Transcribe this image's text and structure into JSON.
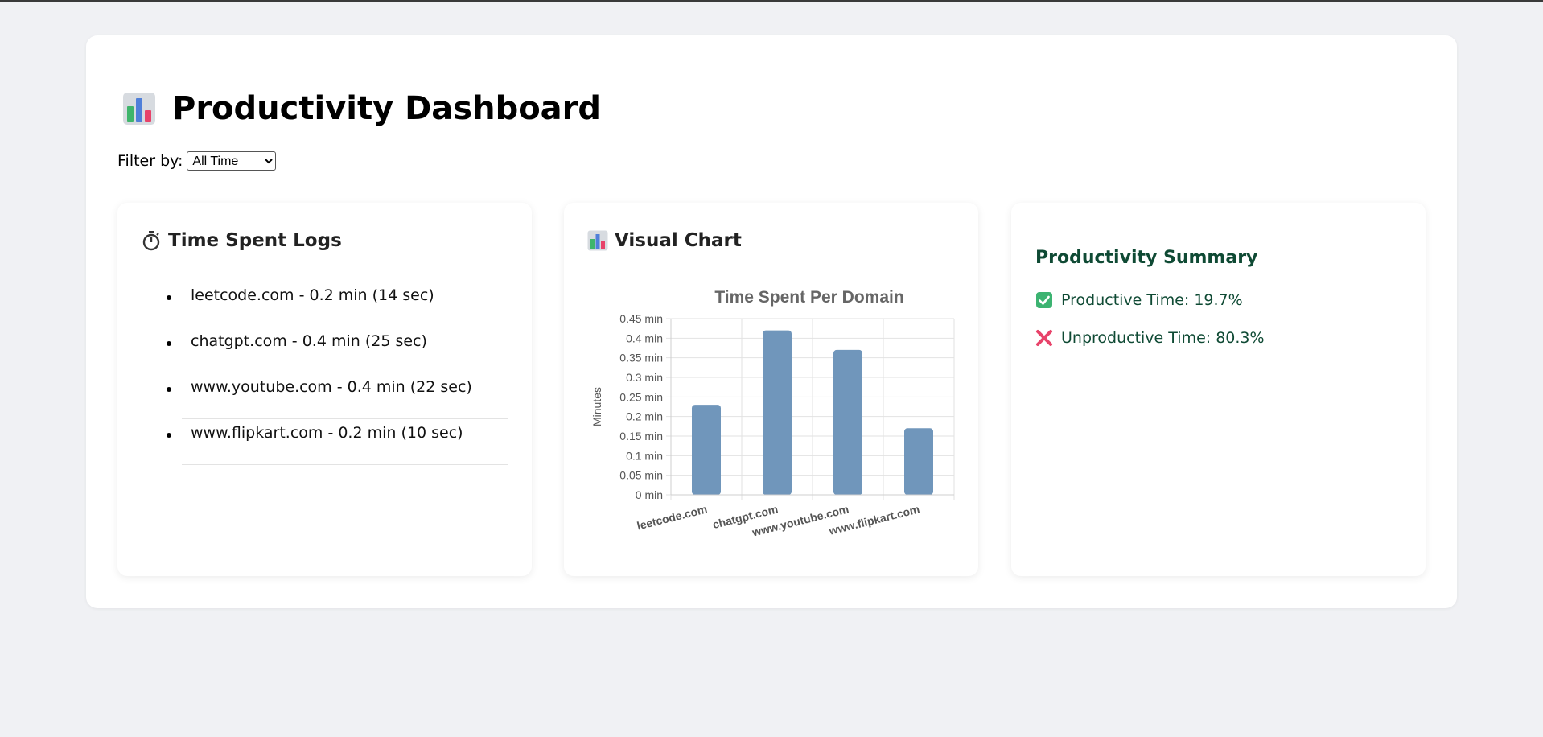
{
  "page": {
    "title": "Productivity Dashboard",
    "title_icon": "bar-chart-icon"
  },
  "filter": {
    "label": "Filter by:",
    "selected": "All Time",
    "options": [
      "All Time"
    ]
  },
  "logs": {
    "heading": "Time Spent Logs",
    "heading_icon": "stopwatch-icon",
    "items": [
      {
        "text": "leetcode.com - 0.2 min (14 sec)"
      },
      {
        "text": "chatgpt.com - 0.4 min (25 sec)"
      },
      {
        "text": "www.youtube.com - 0.4 min (22 sec)"
      },
      {
        "text": "www.flipkart.com - 0.2 min (10 sec)"
      }
    ]
  },
  "chart_panel": {
    "heading": "Visual Chart",
    "heading_icon": "bar-chart-icon"
  },
  "chart_data": {
    "type": "bar",
    "title": "Time Spent Per Domain",
    "xlabel": "",
    "ylabel": "Minutes",
    "categories": [
      "leetcode.com",
      "chatgpt.com",
      "www.youtube.com",
      "www.flipkart.com"
    ],
    "values": [
      0.23,
      0.42,
      0.37,
      0.17
    ],
    "ylim": [
      0,
      0.45
    ],
    "y_ticks": [
      "0 min",
      "0.05 min",
      "0.1 min",
      "0.15 min",
      "0.2 min",
      "0.25 min",
      "0.3 min",
      "0.35 min",
      "0.4 min",
      "0.45 min"
    ],
    "grid": true,
    "bar_color": "#7096bb"
  },
  "summary": {
    "title": "Productivity Summary",
    "productive": "Productive Time: 19.7%",
    "productive_icon": "check-mark-icon",
    "unproductive": "Unproductive Time: 80.3%",
    "unproductive_icon": "cross-mark-icon"
  },
  "colors": {
    "summary_text": "#0f4a34",
    "check_green": "#3cb371",
    "cross_red": "#e8436a"
  }
}
